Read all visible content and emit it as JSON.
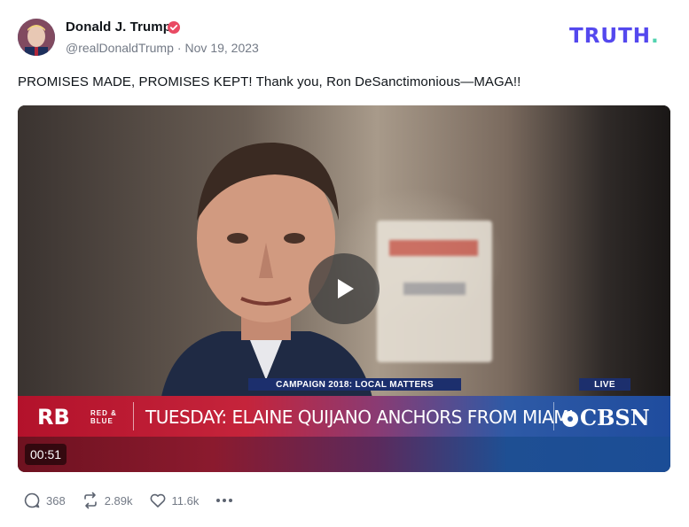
{
  "author": {
    "name": "Donald J. Trump",
    "handle": "@realDonaldTrump",
    "separator": "·",
    "date": "Nov 19, 2023"
  },
  "brand": {
    "logo_text": "TRUTH",
    "logo_dot": ".",
    "logo_color": "#5448ee",
    "dot_color": "#52d3b0"
  },
  "post": {
    "text": "PROMISES MADE, PROMISES KEPT! Thank you, Ron DeSanctimonious—MAGA!!"
  },
  "video": {
    "duration": "00:51",
    "lower_third_top": "CAMPAIGN 2018: LOCAL MATTERS",
    "live_label": "LIVE",
    "network_logo": "RB",
    "network_sub": "RED & BLUE",
    "headline": "TUESDAY: ELAINE QUIJANO ANCHORS FROM MIAMI",
    "channel": "CBSN"
  },
  "actions": {
    "replies": "368",
    "retruths": "2.89k",
    "likes": "11.6k"
  },
  "icons": {
    "reply": "comment-icon",
    "retruth": "repost-icon",
    "like": "heart-icon",
    "more": "more-icon",
    "verified": "verified-badge-icon",
    "play": "play-icon"
  }
}
